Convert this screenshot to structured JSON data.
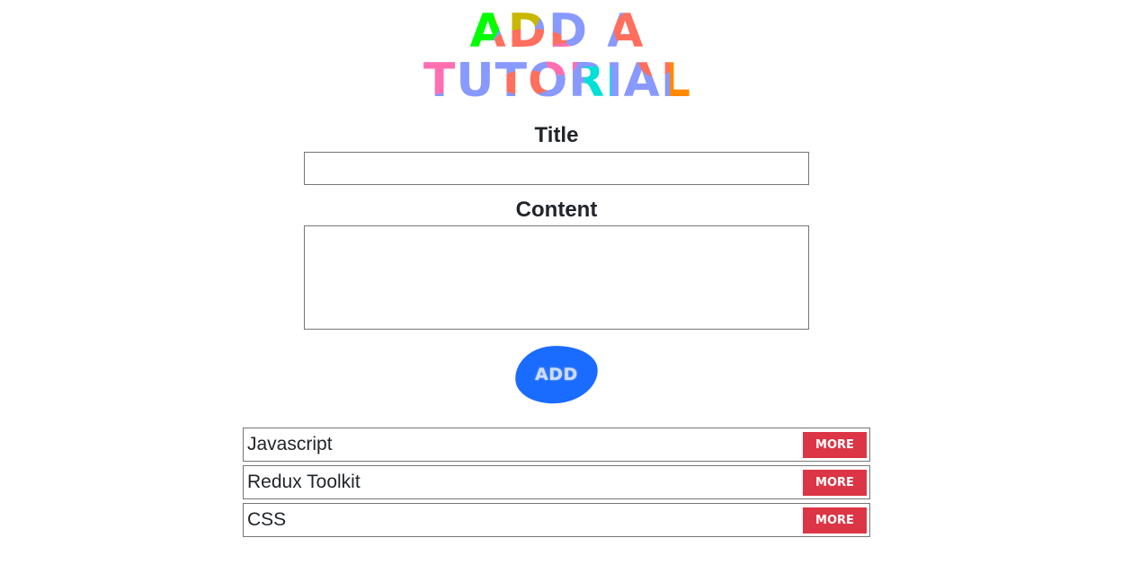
{
  "header": {
    "logo_text": "ADD A TUTORIAL",
    "logo_colors": [
      "#00ff00",
      "#c9b700",
      "#8899ff",
      "#ff6f5e",
      "#ff6fb0",
      "#00e0d8",
      "#ff8a00"
    ]
  },
  "form": {
    "title_label": "Title",
    "title_value": "",
    "content_label": "Content",
    "content_value": "",
    "add_button_label": "ADD",
    "add_button_color": "#1a6bff"
  },
  "tutorials": {
    "more_button_color": "#dc3545",
    "items": [
      {
        "name": "Javascript",
        "button_label": "MORE"
      },
      {
        "name": "Redux Toolkit",
        "button_label": "MORE"
      },
      {
        "name": "CSS",
        "button_label": "MORE"
      }
    ]
  }
}
